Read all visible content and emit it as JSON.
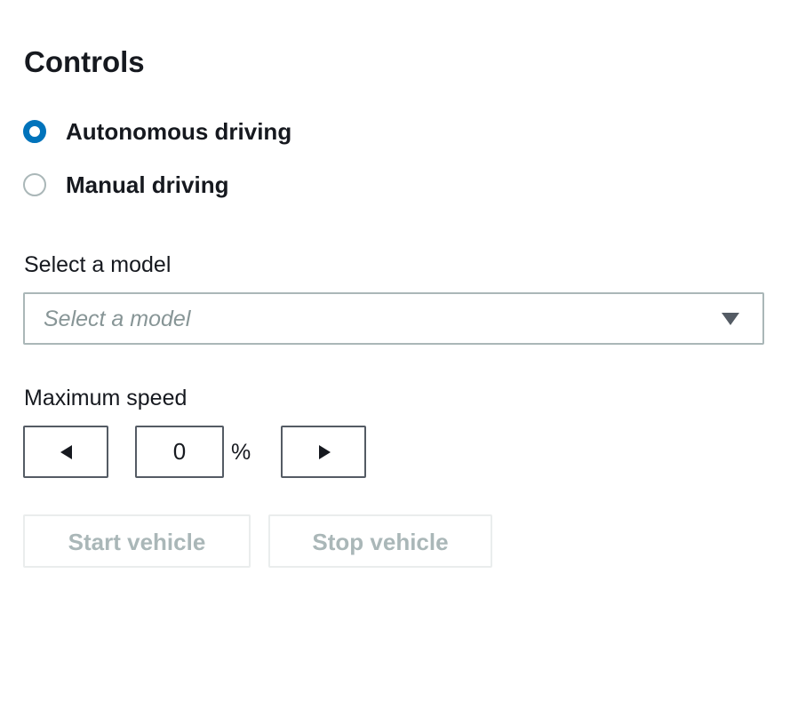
{
  "controls": {
    "title": "Controls",
    "driving_mode": {
      "options": [
        {
          "label": "Autonomous driving",
          "selected": true
        },
        {
          "label": "Manual driving",
          "selected": false
        }
      ]
    },
    "model_select": {
      "label": "Select a model",
      "placeholder": "Select a model",
      "value": ""
    },
    "max_speed": {
      "label": "Maximum speed",
      "value": "0",
      "unit": "%"
    },
    "buttons": {
      "start_label": "Start vehicle",
      "stop_label": "Stop vehicle",
      "enabled": false
    }
  },
  "colors": {
    "accent": "#0073bb",
    "text": "#16191f",
    "border": "#aab7b8",
    "disabled_text": "#aab7b8",
    "disabled_border": "#eaeded",
    "placeholder": "#879596"
  },
  "icons": {
    "select_caret": "caret-down-icon",
    "decrease": "triangle-left-icon",
    "increase": "triangle-right-icon"
  }
}
